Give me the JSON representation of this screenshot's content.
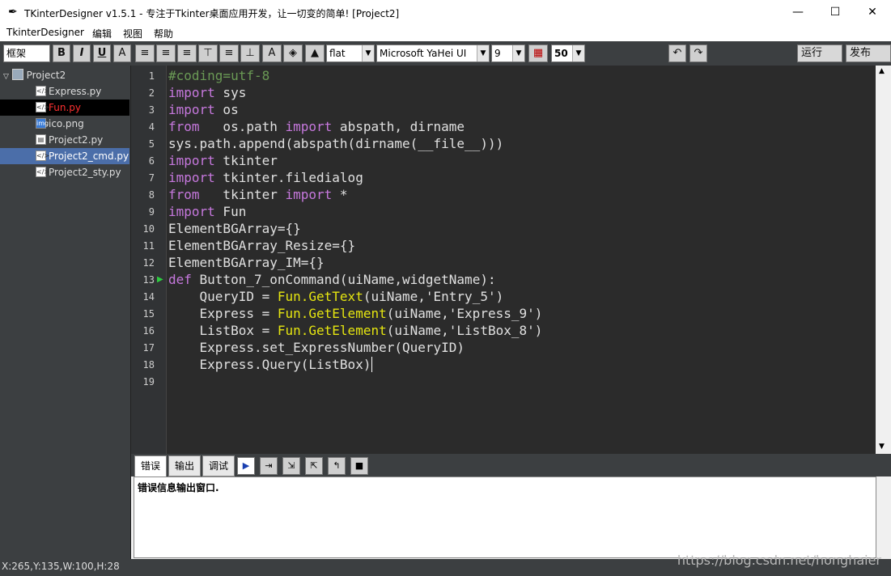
{
  "window": {
    "title": "TKinterDesigner v1.5.1 - 专注于Tkinter桌面应用开发，让一切变的简单!   [Project2]",
    "minimize": "—",
    "maximize": "☐",
    "close": "✕"
  },
  "menu": [
    "TkinterDesigner",
    "编辑",
    "视图",
    "帮助"
  ],
  "toolbar": {
    "frame_label": "框架",
    "bold": "B",
    "italic": "I",
    "underline": "U",
    "font_color": "A",
    "relief_value": "flat",
    "font_value": "Microsoft YaHei UI",
    "size_value": "9",
    "alpha_value": "50",
    "run_label": "运行",
    "publish_label": "发布"
  },
  "tree": {
    "root": "Project2",
    "items": [
      {
        "name": "Express.py",
        "icon": "</>"
      },
      {
        "name": "Fun.py",
        "icon": "</>"
      },
      {
        "name": "ico.png",
        "icon": "img"
      },
      {
        "name": "Project2.py",
        "icon": "▤"
      },
      {
        "name": "Project2_cmd.py",
        "icon": "</>"
      },
      {
        "name": "Project2_sty.py",
        "icon": "</>"
      }
    ]
  },
  "colors": {
    "keyword": "#c678dd",
    "comment": "#6a9955",
    "func": "#e5e510",
    "text": "#e0e0e0",
    "selected_file": "#ff3030",
    "selection_bg": "#4b6ea9"
  },
  "code": {
    "lines": [
      [
        {
          "t": "#coding=utf-8",
          "c": "comment"
        }
      ],
      [
        {
          "t": "import",
          "c": "keyword"
        },
        {
          "t": " sys",
          "c": "text"
        }
      ],
      [
        {
          "t": "import",
          "c": "keyword"
        },
        {
          "t": " os",
          "c": "text"
        }
      ],
      [
        {
          "t": "from",
          "c": "keyword"
        },
        {
          "t": "   os.path ",
          "c": "text"
        },
        {
          "t": "import",
          "c": "keyword"
        },
        {
          "t": " abspath, dirname",
          "c": "text"
        }
      ],
      [
        {
          "t": "sys.path.append(abspath(dirname(__file__)))",
          "c": "text"
        }
      ],
      [
        {
          "t": "import",
          "c": "keyword"
        },
        {
          "t": " tkinter",
          "c": "text"
        }
      ],
      [
        {
          "t": "import",
          "c": "keyword"
        },
        {
          "t": " tkinter.filedialog",
          "c": "text"
        }
      ],
      [
        {
          "t": "from",
          "c": "keyword"
        },
        {
          "t": "   tkinter ",
          "c": "text"
        },
        {
          "t": "import",
          "c": "keyword"
        },
        {
          "t": " *",
          "c": "text"
        }
      ],
      [
        {
          "t": "import",
          "c": "keyword"
        },
        {
          "t": " Fun",
          "c": "text"
        }
      ],
      [
        {
          "t": "ElementBGArray={}",
          "c": "text"
        }
      ],
      [
        {
          "t": "ElementBGArray_Resize={}",
          "c": "text"
        }
      ],
      [
        {
          "t": "ElementBGArray_IM={}",
          "c": "text"
        }
      ],
      [
        {
          "t": "def",
          "c": "keyword"
        },
        {
          "t": " Button_7_onCommand(uiName,widgetName):",
          "c": "text"
        }
      ],
      [
        {
          "t": "    QueryID = ",
          "c": "text"
        },
        {
          "t": "Fun.GetText",
          "c": "func"
        },
        {
          "t": "(uiName,'Entry_5')",
          "c": "text"
        }
      ],
      [
        {
          "t": "    Express = ",
          "c": "text"
        },
        {
          "t": "Fun.GetElement",
          "c": "func"
        },
        {
          "t": "(uiName,'Express_9')",
          "c": "text"
        }
      ],
      [
        {
          "t": "    ListBox = ",
          "c": "text"
        },
        {
          "t": "Fun.GetElement",
          "c": "func"
        },
        {
          "t": "(uiName,'ListBox_8')",
          "c": "text"
        }
      ],
      [
        {
          "t": "    Express.set_ExpressNumber(QueryID)",
          "c": "text"
        }
      ],
      [
        {
          "t": "    Express.Query(ListBox)",
          "c": "text"
        }
      ],
      []
    ],
    "line_numbers": [
      "1",
      "2",
      "3",
      "4",
      "5",
      "6",
      "7",
      "8",
      "9",
      "10",
      "11",
      "12",
      "13",
      "14",
      "15",
      "16",
      "17",
      "18",
      "19"
    ]
  },
  "bottom": {
    "tabs": [
      "错误",
      "输出",
      "调试"
    ],
    "message": "错误信息输出窗口."
  },
  "status": {
    "coords": "X:265,Y:135,W:100,H:28",
    "watermark": "https://blog.csdn.net/honghaier"
  }
}
